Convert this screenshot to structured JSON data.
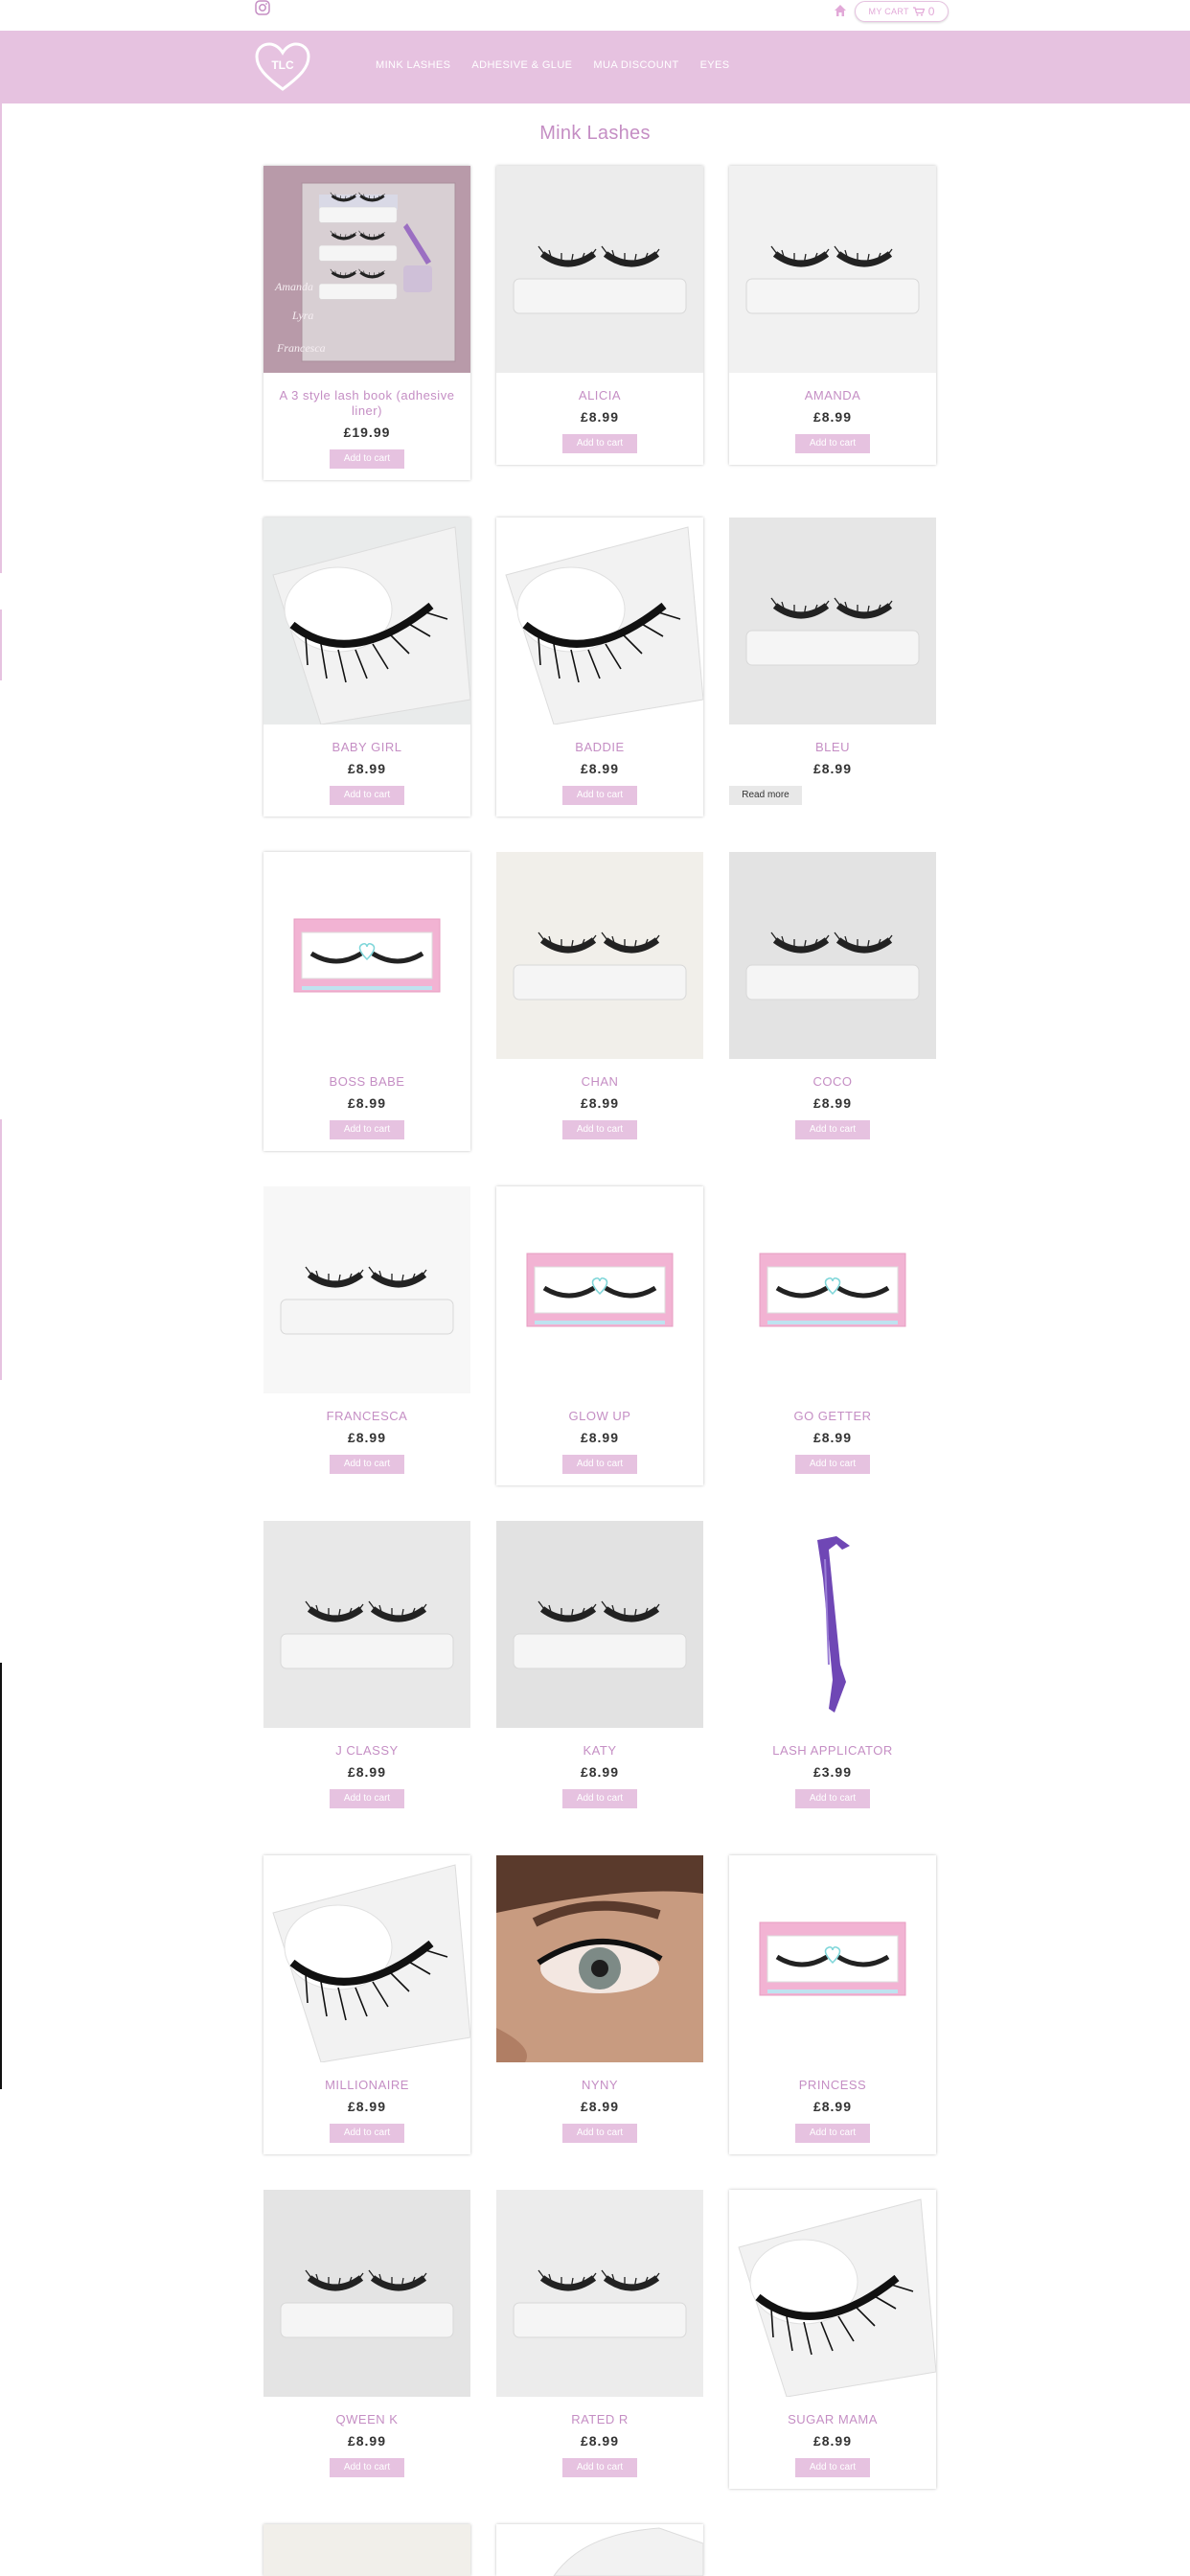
{
  "header": {
    "cart_label": "MY CART",
    "cart_count": "0",
    "nav": [
      "MINK LASHES",
      "ADHESIVE & GLUE",
      "MUA DISCOUNT",
      "EYES"
    ],
    "logo_text": "TLC"
  },
  "page_title": "Mink Lashes",
  "colors": {
    "accent": "#e6c2e0",
    "title": "#c58ec4"
  },
  "products": [
    {
      "name": "A 3 style lash book (adhesive liner)",
      "price": "£19.99",
      "button": "Add to cart"
    },
    {
      "name": "ALICIA",
      "price": "£8.99",
      "button": "Add to cart"
    },
    {
      "name": "AMANDA",
      "price": "£8.99",
      "button": "Add to cart"
    },
    {
      "name": "BABY GIRL",
      "price": "£8.99",
      "button": "Add to cart"
    },
    {
      "name": "BADDIE",
      "price": "£8.99",
      "button": "Add to cart"
    },
    {
      "name": "BLEU",
      "price": "£8.99",
      "button": "Read more"
    },
    {
      "name": "BOSS BABE",
      "price": "£8.99",
      "button": "Add to cart"
    },
    {
      "name": "CHAN",
      "price": "£8.99",
      "button": "Add to cart"
    },
    {
      "name": "COCO",
      "price": "£8.99",
      "button": "Add to cart"
    },
    {
      "name": "FRANCESCA",
      "price": "£8.99",
      "button": "Add to cart"
    },
    {
      "name": "GLOW UP",
      "price": "£8.99",
      "button": "Add to cart"
    },
    {
      "name": "GO GETTER",
      "price": "£8.99",
      "button": "Add to cart"
    },
    {
      "name": "J CLASSY",
      "price": "£8.99",
      "button": "Add to cart"
    },
    {
      "name": "KATY",
      "price": "£8.99",
      "button": "Add to cart"
    },
    {
      "name": "LASH APPLICATOR",
      "price": "£3.99",
      "button": "Add to cart"
    },
    {
      "name": "MILLIONAIRE",
      "price": "£8.99",
      "button": "Add to cart"
    },
    {
      "name": "NYNY",
      "price": "£8.99",
      "button": "Add to cart"
    },
    {
      "name": "PRINCESS",
      "price": "£8.99",
      "button": "Add to cart"
    },
    {
      "name": "QWEEN K",
      "price": "£8.99",
      "button": "Add to cart"
    },
    {
      "name": "RATED R",
      "price": "£8.99",
      "button": "Add to cart"
    },
    {
      "name": "SUGAR MAMA",
      "price": "£8.99",
      "button": "Add to cart"
    }
  ]
}
